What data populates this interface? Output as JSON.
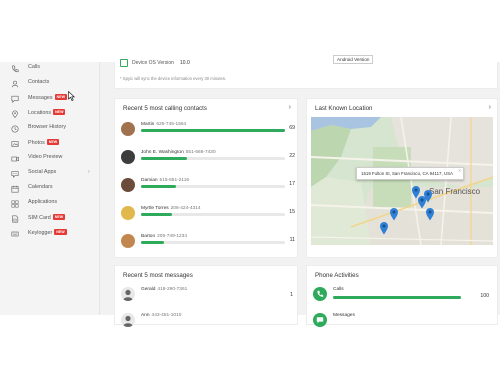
{
  "sidebar": {
    "items": [
      {
        "label": "Calls",
        "icon": "calls-icon",
        "badge": ""
      },
      {
        "label": "Contacts",
        "icon": "contacts-icon",
        "badge": ""
      },
      {
        "label": "Messages",
        "icon": "messages-icon",
        "badge": "NEW"
      },
      {
        "label": "Locations",
        "icon": "location-pin-icon",
        "badge": "NEW"
      },
      {
        "label": "Browser History",
        "icon": "browser-history-icon",
        "badge": ""
      },
      {
        "label": "Photos",
        "icon": "photos-icon",
        "badge": "NEW"
      },
      {
        "label": "Video Preview",
        "icon": "video-icon",
        "badge": ""
      },
      {
        "label": "Social Apps",
        "icon": "social-apps-icon",
        "badge": ""
      },
      {
        "label": "Calendars",
        "icon": "calendar-icon",
        "badge": ""
      },
      {
        "label": "Applications",
        "icon": "applications-icon",
        "badge": ""
      },
      {
        "label": "SIM Card",
        "icon": "sim-card-icon",
        "badge": "NEW"
      },
      {
        "label": "Keylogger",
        "icon": "keylogger-icon",
        "badge": "NEW"
      }
    ]
  },
  "device": {
    "os_label": "Device OS Version",
    "os_value": "10.0",
    "tooltip": "Android Version",
    "sync_note": "* Spyic will sync the device information every 30 minutes."
  },
  "calling": {
    "title": "Recent 5 most calling contacts",
    "max": 69,
    "contacts": [
      {
        "name": "Martin",
        "phone": "625-745-1564",
        "count": 69,
        "avatar_color": "#a0724e"
      },
      {
        "name": "John E. Washington",
        "phone": "551-666-7430",
        "count": 22,
        "avatar_color": "#3d3d3d"
      },
      {
        "name": "Damian",
        "phone": "515-651-2116",
        "count": 17,
        "avatar_color": "#6b4b3a"
      },
      {
        "name": "Myrtle Torres",
        "phone": "206-424-4314",
        "count": 15,
        "avatar_color": "#e0b84c"
      },
      {
        "name": "Barton",
        "phone": "205-749-1234",
        "count": 11,
        "avatar_color": "#c2864f"
      }
    ]
  },
  "location": {
    "title": "Last Known Location",
    "address": "1519 Fulton St, San Francisco, CA 94117, USA",
    "close_label": "×",
    "map_label": "San Francisco"
  },
  "messages": {
    "title": "Recent 5 most messages",
    "items": [
      {
        "name": "Gerald",
        "phone": "418-290-7361",
        "count": 1
      },
      {
        "name": "Ann",
        "phone": "443-451-1010",
        "count": ""
      }
    ]
  },
  "phone_activities": {
    "title": "Phone Activities",
    "items": [
      {
        "label": "Calls",
        "value": 100
      },
      {
        "label": "Messages",
        "value": ""
      }
    ]
  },
  "colors": {
    "accent_green": "#2eaa5c",
    "badge_red": "#e53935",
    "pin_blue": "#2f80d6"
  }
}
